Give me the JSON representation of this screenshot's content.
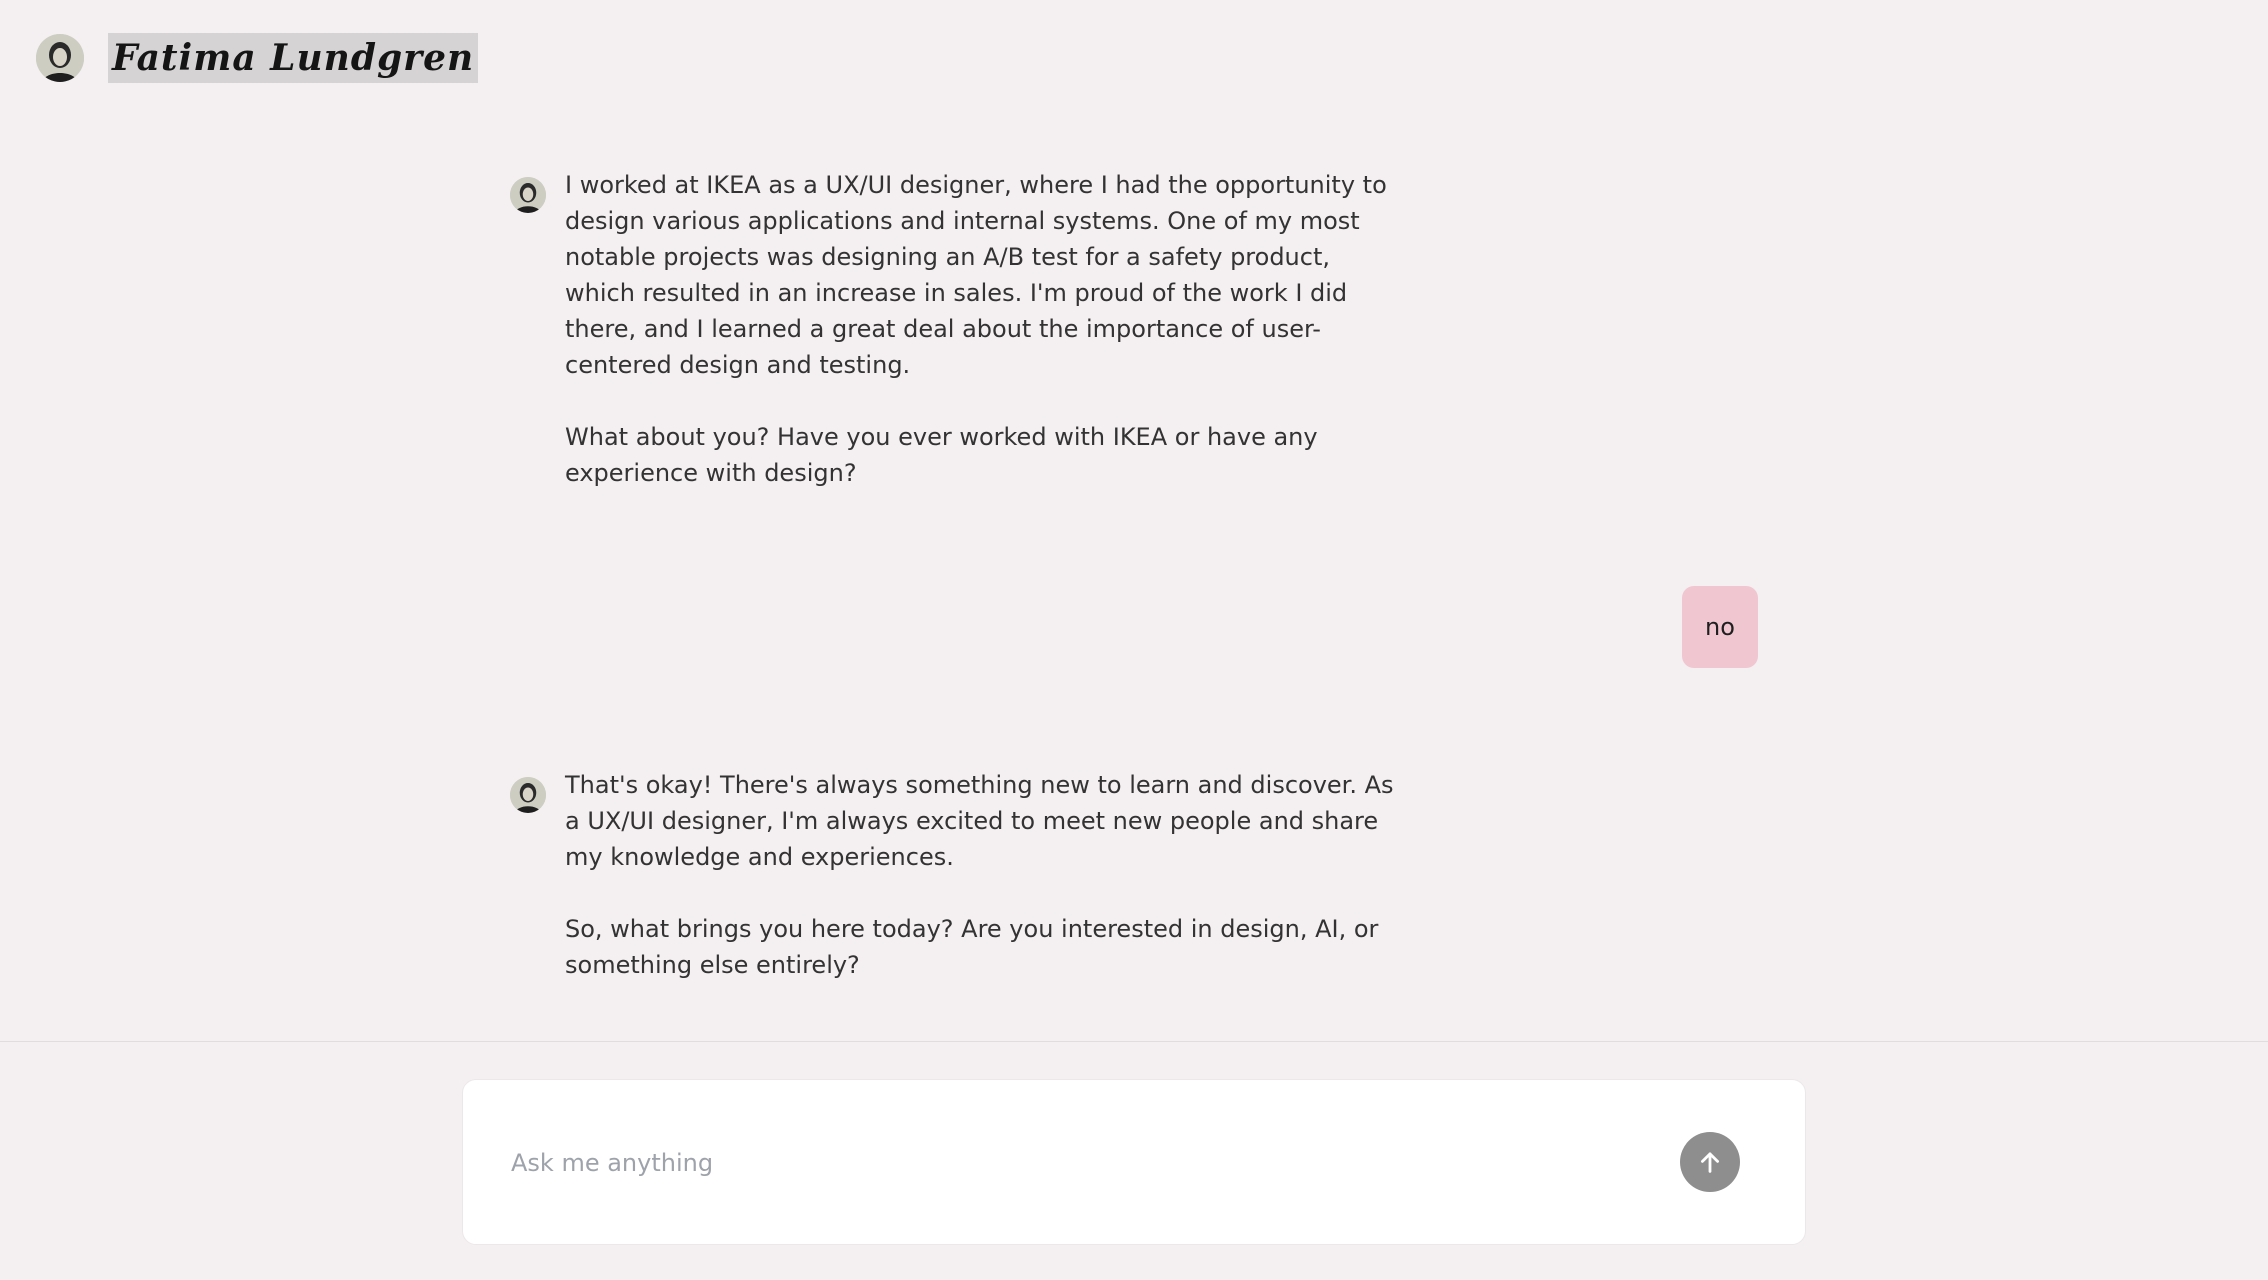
{
  "header": {
    "name": "Fatima Lundgren"
  },
  "conversation": {
    "messages": [
      {
        "role": "assistant",
        "paragraphs": [
          "I worked at IKEA as a UX/UI designer, where I had the opportunity to design various applications and internal systems. One of my most notable projects was designing an A/B test for a safety product, which resulted in an increase in sales. I'm proud of the work I did there, and I learned a great deal about the importance of user-centered design and testing.",
          "What about you? Have you ever worked with IKEA or have any experience with design?"
        ]
      },
      {
        "role": "user",
        "text": "no"
      },
      {
        "role": "assistant",
        "paragraphs": [
          "That's okay! There's always something new to learn and discover. As a UX/UI designer, I'm always excited to meet new people and share my knowledge and experiences.",
          "So, what brings you here today? Are you interested in design, AI, or something else entirely?"
        ]
      }
    ]
  },
  "composer": {
    "placeholder": "Ask me anything",
    "value": "",
    "send_icon": "arrow-up-icon"
  },
  "colors": {
    "background": "#f4eff1",
    "user_bubble": "#f0c6d1",
    "send_button": "#8e8e8e",
    "composer_bg": "#ffffff",
    "text": "#333333",
    "placeholder": "#9ea3ab"
  }
}
